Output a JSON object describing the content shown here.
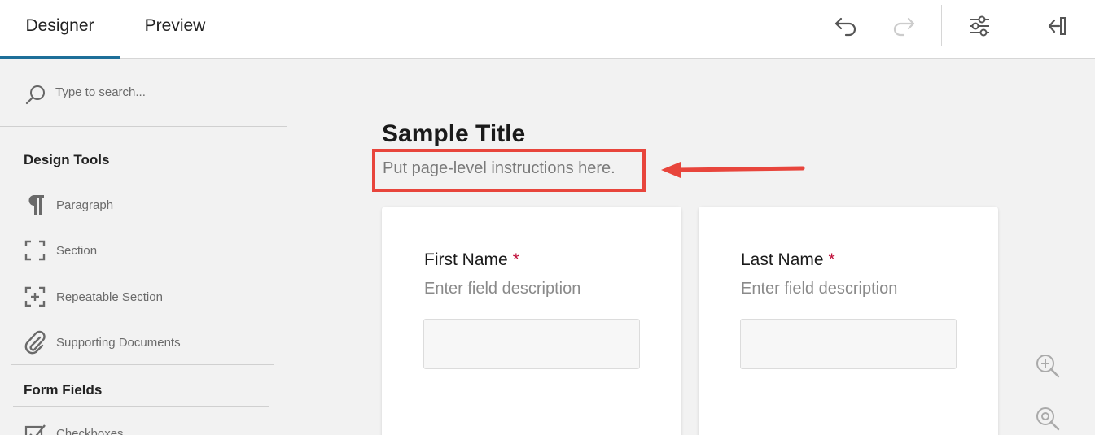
{
  "tabs": {
    "designer": "Designer",
    "preview": "Preview"
  },
  "toolbar": {
    "undo_icon": "undo-arrow",
    "redo_icon": "redo-arrow",
    "settings_icon": "sliders",
    "collapse_icon": "collapse-right-panel"
  },
  "sidebar": {
    "search_placeholder": "Type to search...",
    "design_tools_heading": "Design Tools",
    "design_tools": [
      {
        "label": "Paragraph",
        "icon": "pilcrow"
      },
      {
        "label": "Section",
        "icon": "section-brackets"
      },
      {
        "label": "Repeatable Section",
        "icon": "section-brackets-plus"
      },
      {
        "label": "Supporting Documents",
        "icon": "paperclip"
      }
    ],
    "form_fields_heading": "Form Fields",
    "form_fields": [
      {
        "label": "Checkboxes",
        "icon": "checkbox"
      }
    ]
  },
  "canvas": {
    "title": "Sample Title",
    "instructions": "Put page-level instructions here.",
    "fields": [
      {
        "label": "First Name",
        "required_mark": "*",
        "description": "Enter field description"
      },
      {
        "label": "Last Name",
        "required_mark": "*",
        "description": "Enter field description"
      }
    ]
  },
  "colors": {
    "accent": "#1d6f99",
    "highlight": "#e8453c",
    "required": "#c0103a"
  }
}
